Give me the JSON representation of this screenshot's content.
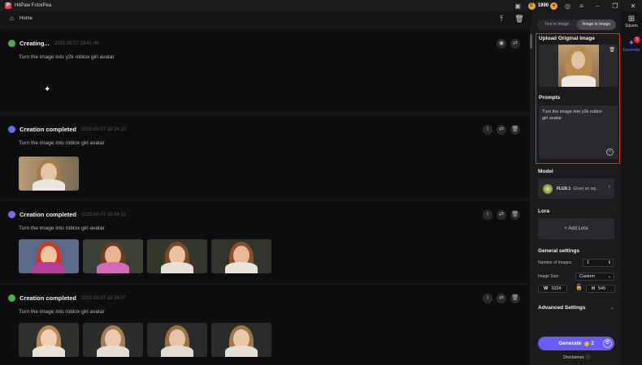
{
  "app": {
    "title": "HitPaw FotorPea"
  },
  "titlebar": {
    "credits": "1990"
  },
  "home": {
    "label": "Home"
  },
  "feed": [
    {
      "status": "Creating...",
      "time": "2025.08.07  18:41:46",
      "prompt": "Turn the image into y2k roblox girl avatar",
      "image_count": 0,
      "dot_color": "#4caf50"
    },
    {
      "status": "Creation completed",
      "time": "2025.08.07  18:34:20",
      "prompt": "Turn the image into roblox girl avatar",
      "image_count": 1,
      "dot_color": "#5b6cff"
    },
    {
      "status": "Creation completed",
      "time": "2025.08.07  18:34:11",
      "prompt": "Turn the image into roblox girl avatar",
      "image_count": 4,
      "dot_color": "#7b6bff"
    },
    {
      "status": "Creation completed",
      "time": "2025.08.07  18:34:07",
      "prompt": "Turn the image into roblox girl avatar",
      "image_count": 4,
      "dot_color": "#4caf50"
    }
  ],
  "panel": {
    "tabs": [
      "Text to Image",
      "Image to Image"
    ],
    "active_tab": "Image to Image",
    "upload_label": "Upload Original Image",
    "prompts_label": "Prompts",
    "prompt_text": "Turn the image into y2k roblox girl avatar",
    "model_label": "Model",
    "model_name": "FLUX.1",
    "model_desc": "Given an inp...",
    "lora_label": "Lora",
    "add_lora": "+ Add Lora",
    "general_label": "General settings",
    "num_images_label": "Number of Images",
    "num_images": "1",
    "image_size_label": "Image Size",
    "image_size": "Custom",
    "width_label": "W",
    "width": "1024",
    "height_label": "H",
    "height": "546",
    "advanced_label": "Advanced Settings",
    "generate_label": "Generate",
    "generate_cost": "2",
    "disclaimer": "Disclaimer"
  },
  "rail": {
    "square_label": "Square",
    "generate_label": "Generate",
    "badge": "1"
  },
  "colors": {
    "accent": "#6a5af9",
    "highlight_border": "#e0262f",
    "coin": "#e8a33a"
  }
}
